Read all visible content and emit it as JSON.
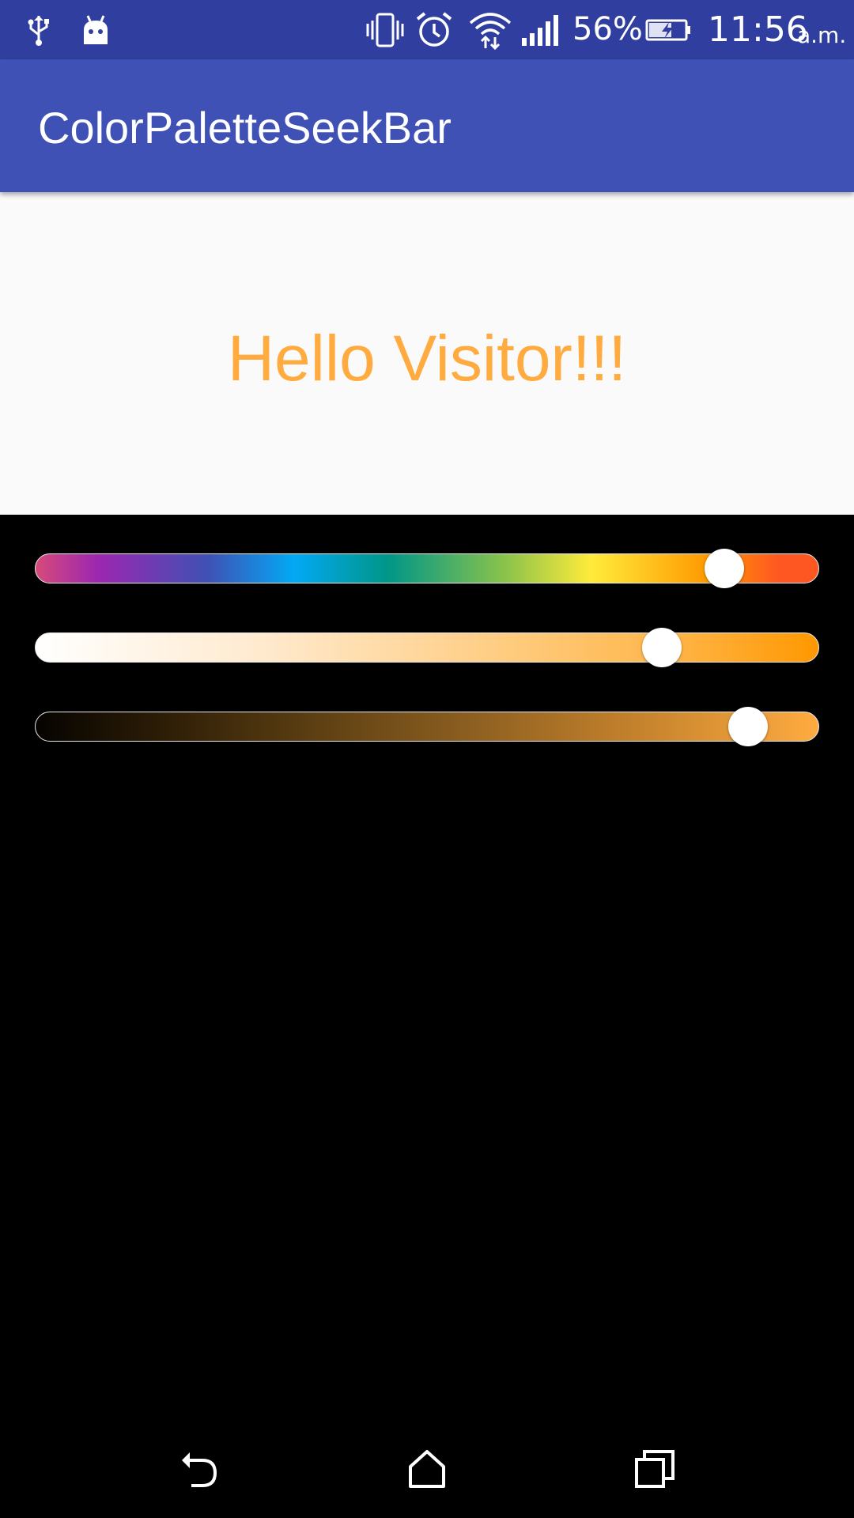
{
  "status_bar": {
    "battery_percent": "56%",
    "time": "11:56",
    "ampm": "a.m.",
    "icons": [
      "usb-icon",
      "android-icon",
      "vibrate-icon",
      "alarm-icon",
      "wifi-icon",
      "signal-icon",
      "battery-charging-icon"
    ]
  },
  "app_bar": {
    "title": "ColorPaletteSeekBar"
  },
  "content": {
    "greeting": "Hello Visitor!!!",
    "greeting_color": "#FFAB40",
    "panel_background": "#FAFAFA"
  },
  "seekbars": [
    {
      "name": "color-palette",
      "progress": 0.88,
      "colors": [
        "#D64A7A",
        "#9C27B0",
        "#3F51B5",
        "#03A9F4",
        "#009688",
        "#8BC34A",
        "#FFEB3B",
        "#FF9800",
        "#FF5722"
      ]
    },
    {
      "name": "tint",
      "progress": 0.8,
      "colors": [
        "#FFFFFF",
        "#FF9800"
      ]
    },
    {
      "name": "shade",
      "progress": 0.91,
      "colors": [
        "#000000",
        "#FFAB40"
      ]
    }
  ],
  "nav_bar": {
    "icons": [
      "back-icon",
      "home-icon",
      "recents-icon"
    ]
  },
  "colors": {
    "primary": "#3F51B5",
    "primary_dark": "#303F9F",
    "accent": "#FFAB40"
  }
}
